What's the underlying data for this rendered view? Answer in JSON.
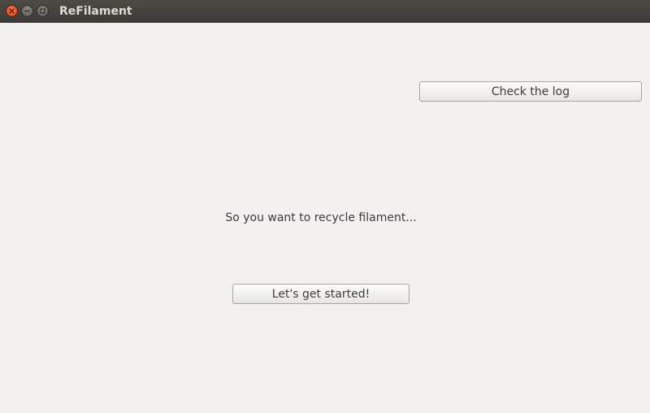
{
  "window": {
    "title": "ReFilament",
    "controls": {
      "close_icon": "close-icon",
      "minimize_icon": "minimize-icon",
      "maximize_icon": "maximize-icon"
    }
  },
  "main": {
    "log_button_label": "Check the log",
    "prompt_text": "So you want to recycle filament...",
    "start_button_label": "Let's get started!"
  },
  "colors": {
    "window_background": "#f2f1f0",
    "titlebar": "#3c3b37",
    "close_button": "#e9562a",
    "title_text": "#dfdbd2"
  }
}
